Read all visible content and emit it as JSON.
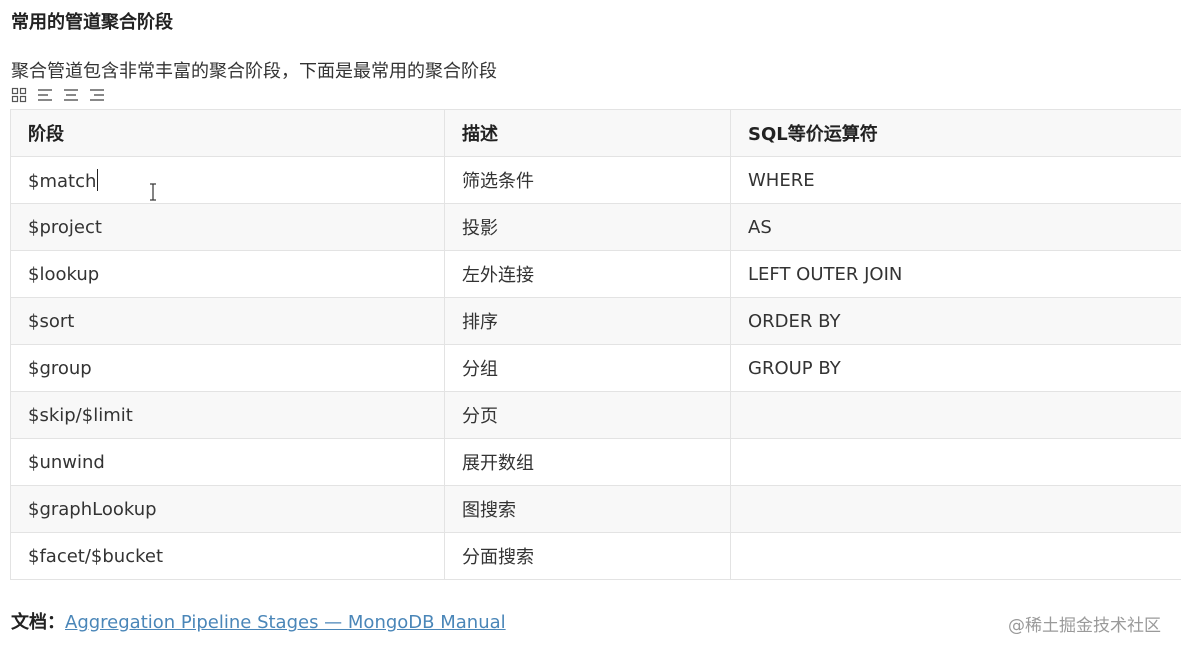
{
  "heading": "常用的管道聚合阶段",
  "intro": "聚合管道包含非常丰富的聚合阶段，下面是最常用的聚合阶段",
  "toolbar": {
    "icons": [
      "grid-icon",
      "align-left-icon",
      "align-center-icon",
      "align-right-icon"
    ]
  },
  "table": {
    "headers": [
      "阶段",
      "描述",
      "SQL等价运算符"
    ],
    "rows": [
      [
        "$match",
        "筛选条件",
        "WHERE"
      ],
      [
        "$project",
        "投影",
        "AS"
      ],
      [
        "$lookup",
        "左外连接",
        "LEFT OUTER JOIN"
      ],
      [
        "$sort",
        "排序",
        "ORDER BY"
      ],
      [
        "$group",
        "分组",
        "GROUP BY"
      ],
      [
        "$skip/$limit",
        "分页",
        ""
      ],
      [
        "$unwind",
        "展开数组",
        ""
      ],
      [
        "$graphLookup",
        "图搜索",
        ""
      ],
      [
        "$facet/$bucket",
        "分面搜索",
        ""
      ]
    ]
  },
  "doc": {
    "label": "文档：",
    "link_text": "Aggregation Pipeline Stages — MongoDB Manual"
  },
  "watermark": "@稀土掘金技术社区",
  "colors": {
    "link": "#4a86b8",
    "border": "#e3e3e3",
    "stripe": "#f8f8f8"
  }
}
